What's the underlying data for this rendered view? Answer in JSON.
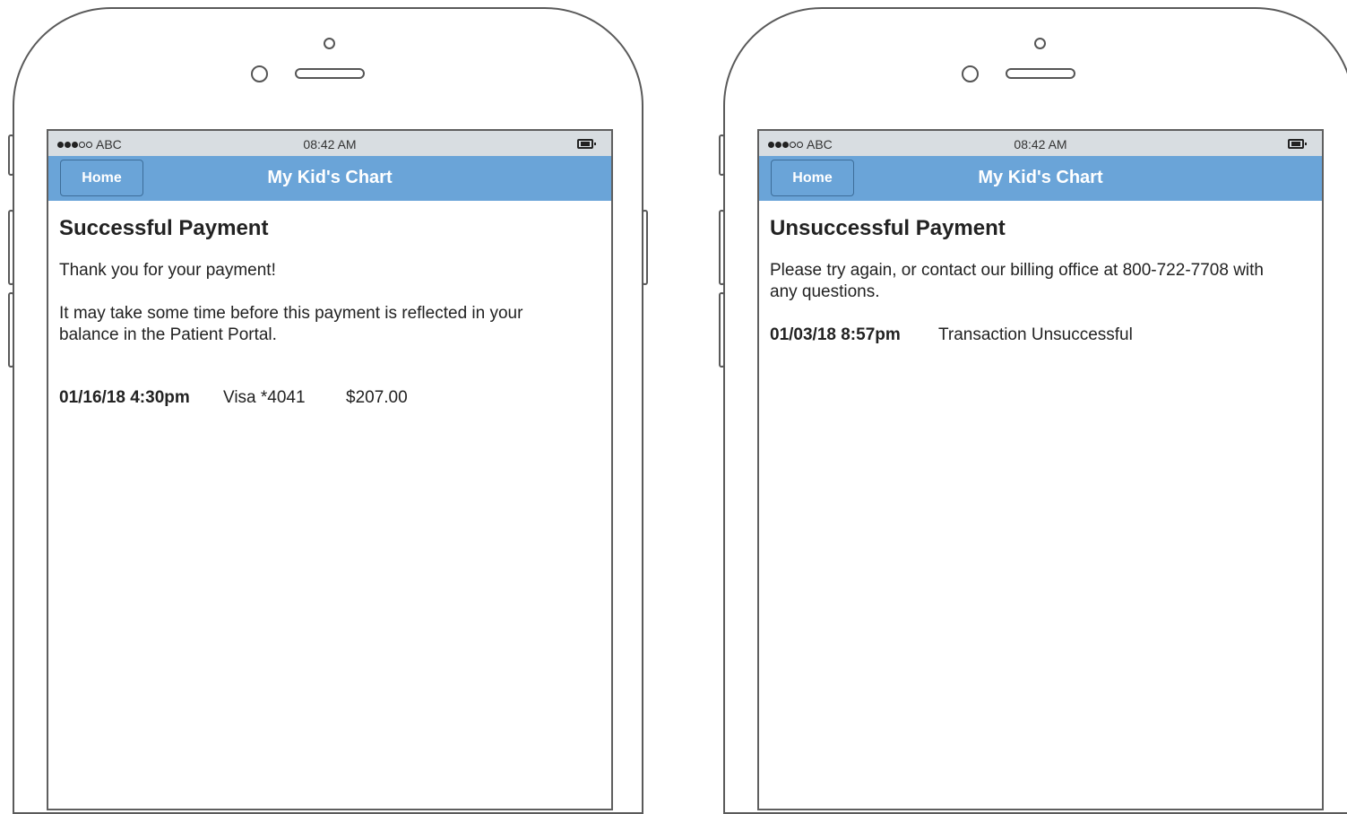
{
  "phones": [
    {
      "statusbar": {
        "carrier": "ABC",
        "time": "08:42 AM"
      },
      "nav": {
        "home_label": "Home",
        "title": "My Kid's Chart"
      },
      "page": {
        "title": "Successful Payment",
        "message1": "Thank you for your payment!",
        "message2": "It may take some time before this payment is reflected in your balance in the Patient Portal."
      },
      "transaction": {
        "datetime": "01/16/18 4:30pm",
        "card": "Visa *4041",
        "amount": "$207.00"
      }
    },
    {
      "statusbar": {
        "carrier": "ABC",
        "time": "08:42 AM"
      },
      "nav": {
        "home_label": "Home",
        "title": "My Kid's Chart"
      },
      "page": {
        "title": "Unsuccessful Payment",
        "message1": "Please try again, or contact our billing office at 800-722-7708 with any questions."
      },
      "transaction": {
        "datetime": "01/03/18 8:57pm",
        "status": "Transaction Unsuccessful"
      }
    }
  ]
}
